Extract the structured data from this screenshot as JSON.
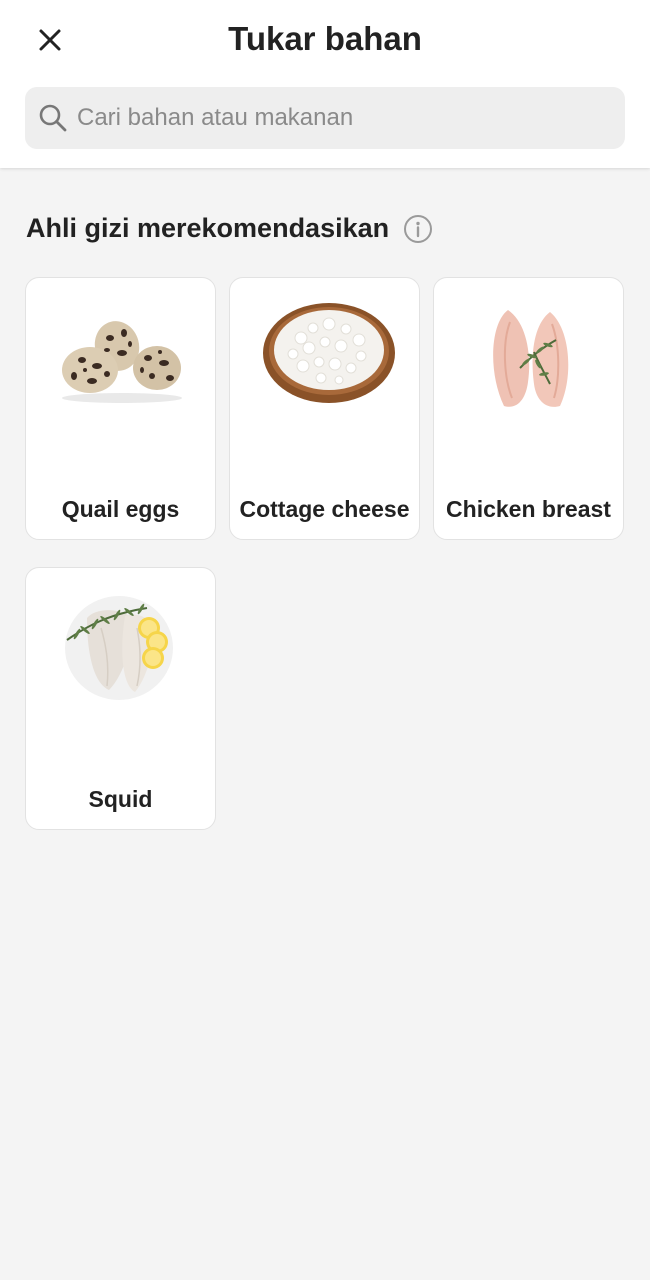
{
  "header": {
    "title": "Tukar bahan",
    "close_icon": "close-icon"
  },
  "search": {
    "placeholder": "Cari bahan atau makanan",
    "value": "",
    "icon": "search-icon"
  },
  "section": {
    "title": "Ahli gizi merekomendasikan",
    "info_icon": "info-icon"
  },
  "items": [
    {
      "label": "Quail eggs",
      "image": "quail-eggs-image"
    },
    {
      "label": "Cottage cheese",
      "image": "cottage-cheese-image"
    },
    {
      "label": "Chicken breast",
      "image": "chicken-breast-image"
    },
    {
      "label": "Squid",
      "image": "squid-image"
    }
  ]
}
